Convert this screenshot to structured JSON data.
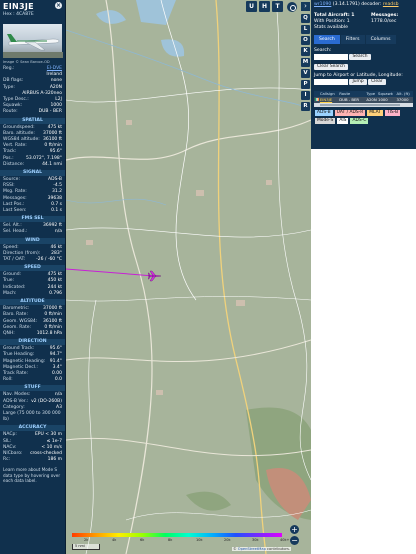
{
  "aircraft": {
    "callsign": "EIN3JE",
    "hex_label": "Hex : 4CA87E",
    "photo_credit": "Image © Sean Barcoe-OD"
  },
  "details": [
    {
      "k": "Reg.:",
      "v": "EI-DVE",
      "link": true
    },
    {
      "k": "",
      "v": "Ireland"
    },
    {
      "k": "DB flags:",
      "v": "none"
    },
    {
      "k": "Type:",
      "v": "A20N"
    },
    {
      "k": "",
      "v": "AIRBUS A-320neo"
    },
    {
      "k": "Type Desc.:",
      "v": "L2J"
    },
    {
      "k": "Squawk:",
      "v": "1000"
    },
    {
      "k": "Route:",
      "v": "DUB - BER"
    }
  ],
  "sections": [
    {
      "title": "SPATIAL",
      "rows": [
        {
          "k": "Groundspeed:",
          "v": "475 kt"
        },
        {
          "k": "Baro. altitude:",
          "v": "37000 ft"
        },
        {
          "k": "WGS84 altitude:",
          "v": "36100 ft"
        },
        {
          "k": "Vert. Rate:",
          "v": "0 ft/min"
        },
        {
          "k": "Track:",
          "v": "95.6°"
        },
        {
          "k": "Pos.:",
          "v": "53.072°, 7.198°"
        },
        {
          "k": "Distance:",
          "v": "44.1 nmi"
        }
      ]
    },
    {
      "title": "SIGNAL",
      "rows": [
        {
          "k": "Source:",
          "v": "ADS-B"
        },
        {
          "k": "RSSI:",
          "v": "-4.5"
        },
        {
          "k": "Msg. Rate:",
          "v": "31.2"
        },
        {
          "k": "Messages:",
          "v": "39638"
        },
        {
          "k": "Last Pos.:",
          "v": "0.7 s"
        },
        {
          "k": "Last Seen:",
          "v": "0.1 s"
        }
      ]
    },
    {
      "title": "FMS SEL",
      "rows": [
        {
          "k": "Sel. Alt.:",
          "v": "36992 ft"
        },
        {
          "k": "Sel. Head.:",
          "v": "n/a"
        }
      ]
    },
    {
      "title": "WIND",
      "rows": [
        {
          "k": "Speed:",
          "v": "46 kt"
        },
        {
          "k": "Direction (from):",
          "v": "283°"
        },
        {
          "k": "TAT / OAT:",
          "v": "-26 / -60 °C"
        }
      ]
    },
    {
      "title": "SPEED",
      "rows": [
        {
          "k": "Ground:",
          "v": "475 kt"
        },
        {
          "k": "True:",
          "v": "450 kt"
        },
        {
          "k": "Indicated:",
          "v": "244 kt"
        },
        {
          "k": "Mach:",
          "v": "0.796"
        }
      ]
    },
    {
      "title": "ALTITUDE",
      "rows": [
        {
          "k": "Barometric:",
          "v": "37000 ft"
        },
        {
          "k": "Baro. Rate:",
          "v": "0 ft/min"
        },
        {
          "k": "Geom. WGS84:",
          "v": "36100 ft"
        },
        {
          "k": "Geom. Rate:",
          "v": "0 ft/min"
        },
        {
          "k": "QNH:",
          "v": "1012.8 hPa"
        }
      ]
    },
    {
      "title": "DIRECTION",
      "rows": [
        {
          "k": "Ground Track:",
          "v": "95.6°"
        },
        {
          "k": "True Heading:",
          "v": "94.7°"
        },
        {
          "k": "Magnetic Heading:",
          "v": "91.4°"
        },
        {
          "k": "Magnetic Decl.:",
          "v": "3.4°"
        },
        {
          "k": "Track Rate:",
          "v": "0.00"
        },
        {
          "k": "Roll:",
          "v": "0.0"
        }
      ]
    },
    {
      "title": "STUFF",
      "rows": [
        {
          "k": "Nav. Modes:",
          "v": "n/a"
        },
        {
          "k": "ADS-B Ver.:",
          "v": "v2 (DO-260B)"
        },
        {
          "k": "Category:",
          "v": "A3"
        },
        {
          "k": "Large (75 000 to 300 000 lb)",
          "v": ""
        }
      ]
    },
    {
      "title": "ACCURACY",
      "rows": [
        {
          "k": "NACp:",
          "v": "EPU < 30 m"
        },
        {
          "k": "SIL:",
          "v": "≤ 1e-7"
        },
        {
          "k": "NACv:",
          "v": "< 10 m/s"
        },
        {
          "k": "NICbaro:",
          "v": "cross-checked"
        },
        {
          "k": "Rc:",
          "v": "186 m"
        }
      ]
    }
  ],
  "footer_text": "Learn more about Mode S data type by hovering over each data label.",
  "map": {
    "top_buttons": [
      "U",
      "H",
      "T"
    ],
    "right_buttons": [
      "Q",
      "L",
      "O",
      "K",
      "M",
      "V",
      "P",
      "I",
      "R"
    ],
    "zoom_in": "+",
    "zoom_out": "−",
    "alt_ticks": [
      "",
      "2k",
      "",
      "4k",
      "",
      "6k",
      "",
      "8k",
      "",
      "10k",
      "",
      "20k",
      "",
      "30k",
      "",
      "40k+"
    ],
    "scale_label": "5 nmi",
    "attribution_prefix": "©",
    "attribution_link": "OpenStreetMap",
    "attribution_suffix": "contributors."
  },
  "side": {
    "version_link": "wr1090",
    "version_text": " (3.14.1791) decoder: ",
    "version_status": "readsb",
    "total_aircraft_label": "Total Aircraft: 1",
    "messages_label": "Messages:",
    "with_position_label": "With Position: 1",
    "messages_value": "1778.0/sec",
    "stats_label": "Stats available",
    "tabs": [
      "Search",
      "Filters",
      "Columns"
    ],
    "search_label": "Search:",
    "search_button": "Search",
    "clear_search": "Clear Search",
    "jump_label": "Jump to Airport or Latitude, Longitude:",
    "jump_button": "Jump",
    "clear_button": "Clear",
    "table_headers": [
      "",
      "Callsign",
      "Route",
      "Type",
      "Squawk",
      "Alt. (ft)"
    ],
    "table_rows": [
      [
        "",
        "EIN3JE",
        "DUB - BER",
        "A20N",
        "1000",
        "37000"
      ]
    ],
    "legend": [
      {
        "label": "ADS-B",
        "color": "#9bd3ff"
      },
      {
        "label": "UAT / ADS-R",
        "color": "#ffb3b3"
      },
      {
        "label": "MLAT",
        "color": "#ffd17a"
      },
      {
        "label": "TIS-B",
        "color": "#ffb3c8"
      },
      {
        "label": "Mode-S",
        "color": "#d8d8d8"
      },
      {
        "label": "AIS",
        "color": "#ffffff"
      },
      {
        "label": "ADS-C",
        "color": "#b6f0b6"
      }
    ]
  },
  "colors": {
    "panel": "#10304d",
    "header": "#1a4466",
    "track": "#c71fd6",
    "aircraft": "#d22fe0"
  }
}
